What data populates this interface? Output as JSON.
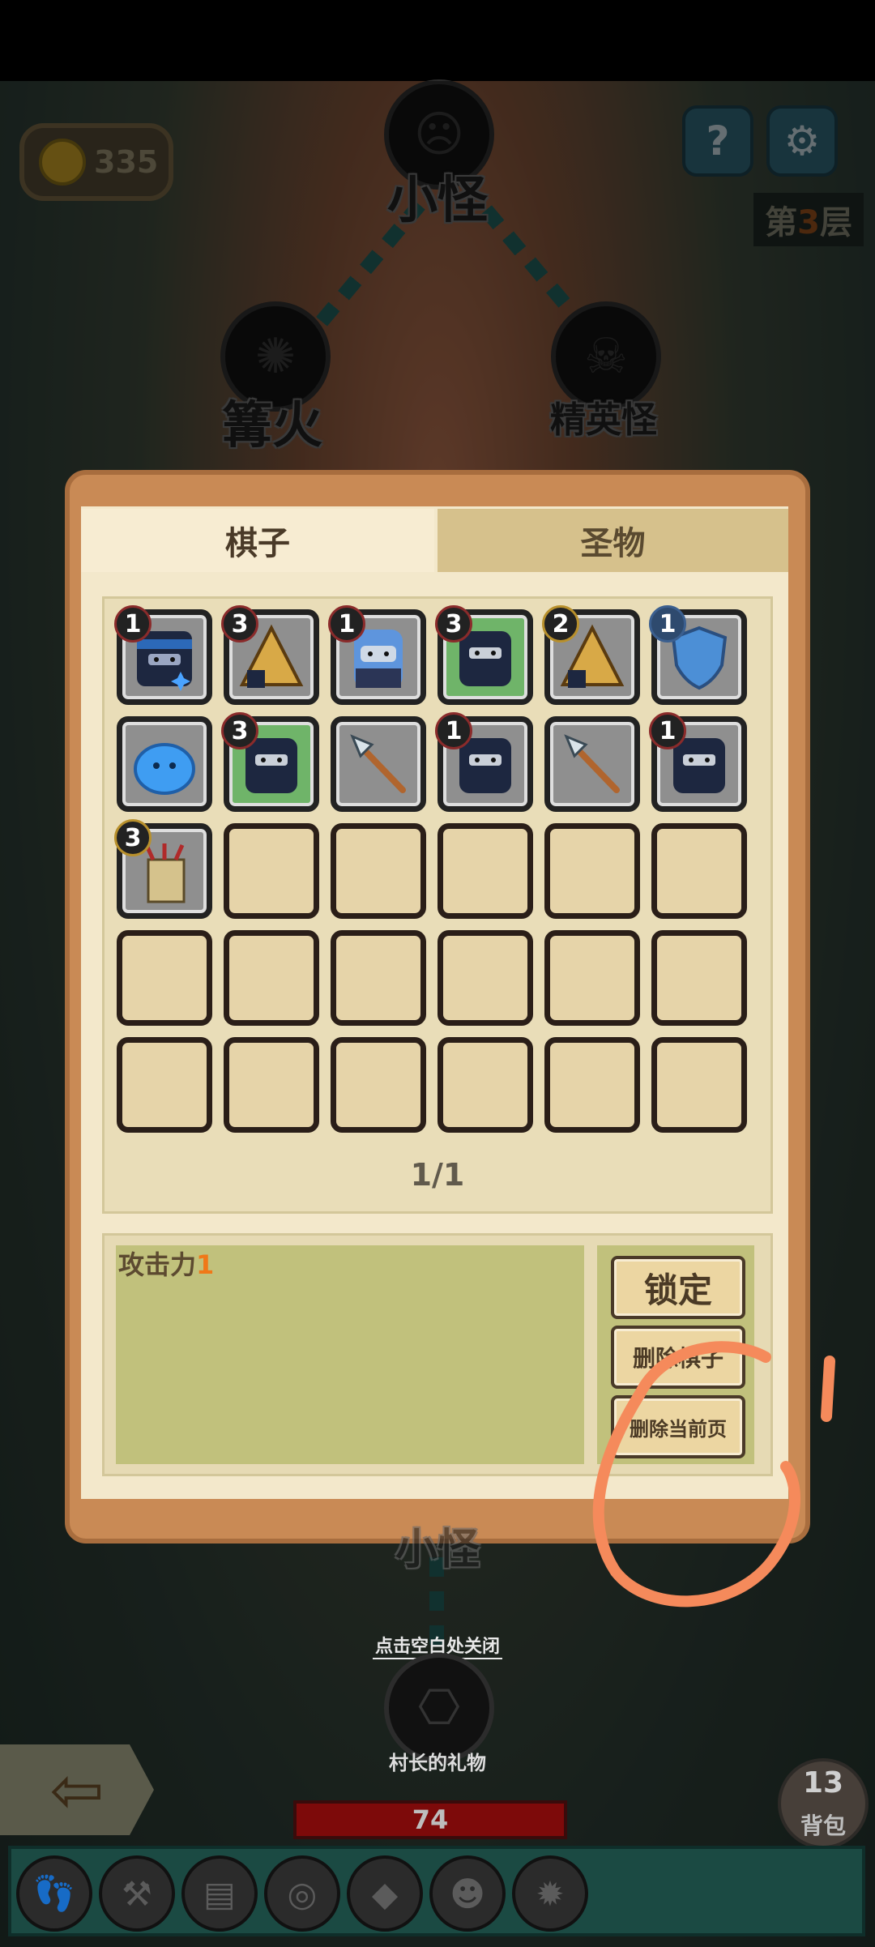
{
  "map": {
    "nodes": {
      "top_label": "小怪",
      "left_label": "篝火",
      "right_label": "精英怪",
      "bottom_partial_label": "小怪",
      "gift_label": "村长的礼物"
    },
    "coins": "335",
    "floor": {
      "prefix": "第",
      "number": "3",
      "suffix": "层"
    },
    "help_icon": "?",
    "settings_icon": "⚙"
  },
  "panel": {
    "tabs": [
      {
        "label": "棋子",
        "active": true
      },
      {
        "label": "圣物",
        "active": false
      }
    ],
    "page": "1/1",
    "attack_label": "攻击力",
    "attack_value": "1",
    "buttons": {
      "lock": "锁定",
      "delete_piece": "删除棋子",
      "delete_page": "删除当前页"
    }
  },
  "pieces": [
    {
      "level": "1",
      "icon": "ninja-blue-headband"
    },
    {
      "level": "3",
      "icon": "tent"
    },
    {
      "level": "1",
      "icon": "blue-hood"
    },
    {
      "level": "3",
      "icon": "ninja-green"
    },
    {
      "level": "2",
      "icon": "tent"
    },
    {
      "level": "1",
      "icon": "shield"
    },
    {
      "level": "",
      "icon": "blue-slime"
    },
    {
      "level": "3",
      "icon": "ninja-green"
    },
    {
      "level": "",
      "icon": "spear"
    },
    {
      "level": "1",
      "icon": "ninja"
    },
    {
      "level": "",
      "icon": "spear"
    },
    {
      "level": "1",
      "icon": "ninja"
    },
    {
      "level": "3",
      "icon": "arrow-quiver"
    }
  ],
  "close_hint": "点击空白处关闭",
  "bag": {
    "count": "13",
    "label": "背包"
  },
  "hp": "74",
  "hotbar_icons": [
    "boots-icon",
    "hammer-icon",
    "book-icon",
    "ring-icon",
    "crystal-icon",
    "ninja-team-icon",
    "rune-icon"
  ],
  "colors": {
    "panel": "#c98a55",
    "inner": "#f3e8cb",
    "accent_orange": "#f07818",
    "annotation": "#f58a5b"
  }
}
